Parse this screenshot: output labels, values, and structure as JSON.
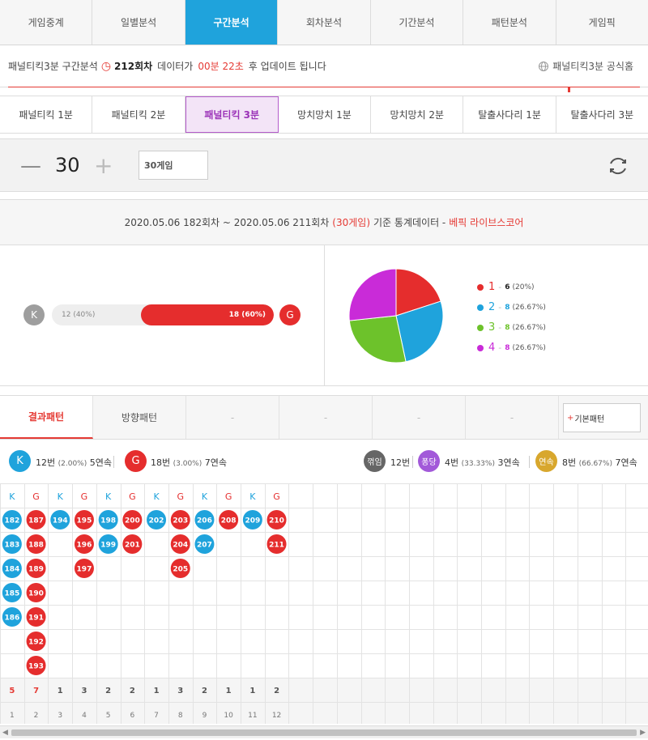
{
  "nav": [
    "게임중계",
    "일별분석",
    "구간분석",
    "회차분석",
    "기간분석",
    "패턴분석",
    "게임픽"
  ],
  "nav_active": 2,
  "update": {
    "game": "패널티킥3분 구간분석",
    "round": "212회차",
    "text1": "데이터가",
    "time": "00분 22초",
    "text2": "후 업데이트 됩니다",
    "official": "패널티킥3분 공식홈"
  },
  "game_tabs": [
    "패널티킥 1분",
    "패널티킥 2분",
    "패널티킥 3분",
    "망치망치 1분",
    "망치망치 2분",
    "탈출사다리 1분",
    "탈출사다리 3분"
  ],
  "game_tab_active": 2,
  "counter": {
    "value": "30",
    "select": "30게임"
  },
  "stats": {
    "range": "2020.05.06 182회차 ~ 2020.05.06 211회차",
    "games": "(30게임)",
    "basis": "기준 통계데이터 -",
    "brand": "베픽 라이브스코어",
    "k_label": "K",
    "g_label": "G",
    "k_text": "12 (40%)",
    "g_text": "18 (60%)",
    "g_share": 0.6
  },
  "pie": [
    {
      "label": "1",
      "count": "6",
      "pct": "(20%)",
      "value": 20,
      "color": "#e52d2d"
    },
    {
      "label": "2",
      "count": "8",
      "pct": "(26.67%)",
      "value": 26.67,
      "color": "#1fa3dc"
    },
    {
      "label": "3",
      "count": "8",
      "pct": "(26.67%)",
      "value": 26.67,
      "color": "#6dc22b"
    },
    {
      "label": "4",
      "count": "8",
      "pct": "(26.67%)",
      "value": 26.67,
      "color": "#c92bd8"
    }
  ],
  "pattern_tabs": [
    "결과패턴",
    "방향패턴",
    "-",
    "-",
    "-",
    "-"
  ],
  "basic_pattern": "기본패턴",
  "summary": {
    "k_badge": "K",
    "k_text": "12번",
    "k_pct": "(2.00%)",
    "k_streak": "5연속",
    "g_badge": "G",
    "g_text": "18번",
    "g_pct": "(3.00%)",
    "g_streak": "7연속",
    "break_badge": "꺾임",
    "break_text": "12번",
    "pong_badge": "퐁당",
    "pong_text": "4번",
    "pong_pct": "(33.33%)",
    "pong_streak": "3연속",
    "cont_badge": "연속",
    "cont_text": "8번",
    "cont_pct": "(66.67%)",
    "cont_streak": "7연속",
    "colors": {
      "k": "#1fa3dc",
      "g": "#e52d2d",
      "break": "#666666",
      "pong": "#a259d9",
      "cont": "#d8a72d"
    }
  },
  "grid": {
    "columns": [
      {
        "head": "K",
        "items": [
          "182",
          "183",
          "184",
          "185",
          "186"
        ],
        "count": "5",
        "idx": "1"
      },
      {
        "head": "G",
        "items": [
          "187",
          "188",
          "189",
          "190",
          "191",
          "192",
          "193"
        ],
        "count": "7",
        "idx": "2"
      },
      {
        "head": "K",
        "items": [
          "194"
        ],
        "count": "1",
        "idx": "3"
      },
      {
        "head": "G",
        "items": [
          "195",
          "196",
          "197"
        ],
        "count": "3",
        "idx": "4"
      },
      {
        "head": "K",
        "items": [
          "198",
          "199"
        ],
        "count": "2",
        "idx": "5"
      },
      {
        "head": "G",
        "items": [
          "200",
          "201"
        ],
        "count": "2",
        "idx": "6"
      },
      {
        "head": "K",
        "items": [
          "202"
        ],
        "count": "1",
        "idx": "7"
      },
      {
        "head": "G",
        "items": [
          "203",
          "204",
          "205"
        ],
        "count": "3",
        "idx": "8"
      },
      {
        "head": "K",
        "items": [
          "206",
          "207"
        ],
        "count": "2",
        "idx": "9"
      },
      {
        "head": "G",
        "items": [
          "208"
        ],
        "count": "1",
        "idx": "10"
      },
      {
        "head": "K",
        "items": [
          "209"
        ],
        "count": "1",
        "idx": "11"
      },
      {
        "head": "G",
        "items": [
          "210",
          "211"
        ],
        "count": "2",
        "idx": "12"
      }
    ],
    "total_columns": 27,
    "rows": 7
  }
}
